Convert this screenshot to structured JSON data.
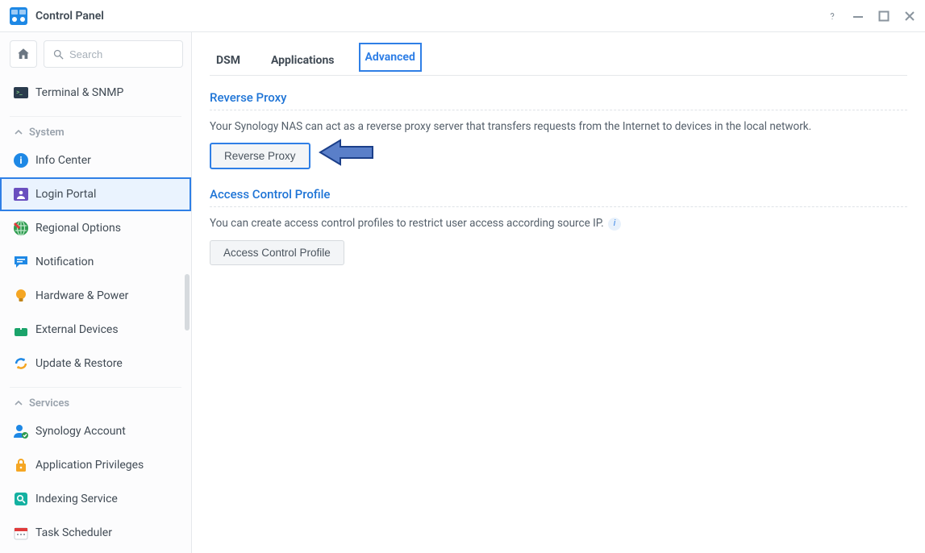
{
  "titlebar": {
    "title": "Control Panel"
  },
  "sidebar": {
    "search_placeholder": "Search",
    "top_items": [
      {
        "key": "terminal",
        "label": "Terminal & SNMP"
      }
    ],
    "sections": [
      {
        "key": "system",
        "label": "System",
        "items": [
          {
            "key": "info",
            "label": "Info Center"
          },
          {
            "key": "login",
            "label": "Login Portal"
          },
          {
            "key": "regional",
            "label": "Regional Options"
          },
          {
            "key": "notification",
            "label": "Notification"
          },
          {
            "key": "hardware",
            "label": "Hardware & Power"
          },
          {
            "key": "external",
            "label": "External Devices"
          },
          {
            "key": "update",
            "label": "Update & Restore"
          }
        ]
      },
      {
        "key": "services",
        "label": "Services",
        "items": [
          {
            "key": "synoacct",
            "label": "Synology Account"
          },
          {
            "key": "appriv",
            "label": "Application Privileges"
          },
          {
            "key": "indexing",
            "label": "Indexing Service"
          },
          {
            "key": "task",
            "label": "Task Scheduler"
          }
        ]
      }
    ],
    "active_item_key": "login"
  },
  "tabs": {
    "items": [
      {
        "key": "dsm",
        "label": "DSM"
      },
      {
        "key": "applications",
        "label": "Applications"
      },
      {
        "key": "advanced",
        "label": "Advanced"
      }
    ],
    "active_key": "advanced"
  },
  "main": {
    "reverse_proxy": {
      "title": "Reverse Proxy",
      "desc": "Your Synology NAS can act as a reverse proxy server that transfers requests from the Internet to devices in the local network.",
      "button": "Reverse Proxy"
    },
    "acp": {
      "title": "Access Control Profile",
      "desc": "You can create access control profiles to restrict user access according source IP.",
      "button": "Access Control Profile"
    }
  },
  "colors": {
    "accent": "#2f7fe6",
    "annot": "#335fbc"
  }
}
